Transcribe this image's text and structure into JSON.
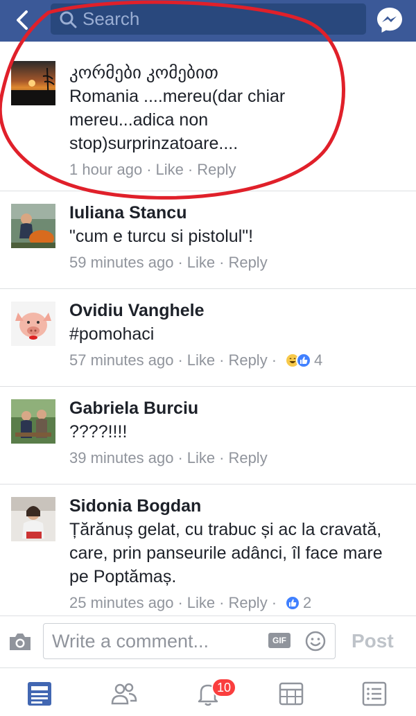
{
  "search": {
    "placeholder": "Search"
  },
  "comments": [
    {
      "name": "კორმები კომებით",
      "text": "Romania ....mereu(dar chiar mereu...adica non stop)surprinzatoare....",
      "time": "1 hour ago",
      "like": "Like",
      "reply": "Reply",
      "reaction_count": ""
    },
    {
      "name": "Iuliana Stancu",
      "text": "\"cum e turcu si pistolul\"!",
      "time": "59 minutes ago",
      "like": "Like",
      "reply": "Reply",
      "reaction_count": ""
    },
    {
      "name": "Ovidiu Vanghele",
      "text": "#pomohaci",
      "time": "57 minutes ago",
      "like": "Like",
      "reply": "Reply",
      "reaction_count": "4"
    },
    {
      "name": "Gabriela Burciu",
      "text": "????!!!!",
      "time": "39 minutes ago",
      "like": "Like",
      "reply": "Reply",
      "reaction_count": ""
    },
    {
      "name": "Sidonia Bogdan",
      "text": "Țărănuș gelat, cu trabuc și ac la cravată, care, prin panseurile adânci, îl face mare pe Poptămaș.",
      "time": "25 minutes ago",
      "like": "Like",
      "reply": "Reply",
      "reaction_count": "2"
    }
  ],
  "composer": {
    "placeholder": "Write a comment...",
    "gif_label": "GIF",
    "post_label": "Post"
  },
  "nav": {
    "notifications_badge": "10"
  },
  "colors": {
    "header": "#3b5998",
    "search_bg": "#29487d",
    "meta_text": "#90949c",
    "annotation": "#e0202a",
    "like_blue": "#4080ff",
    "badge_red": "#fa3e3e"
  }
}
